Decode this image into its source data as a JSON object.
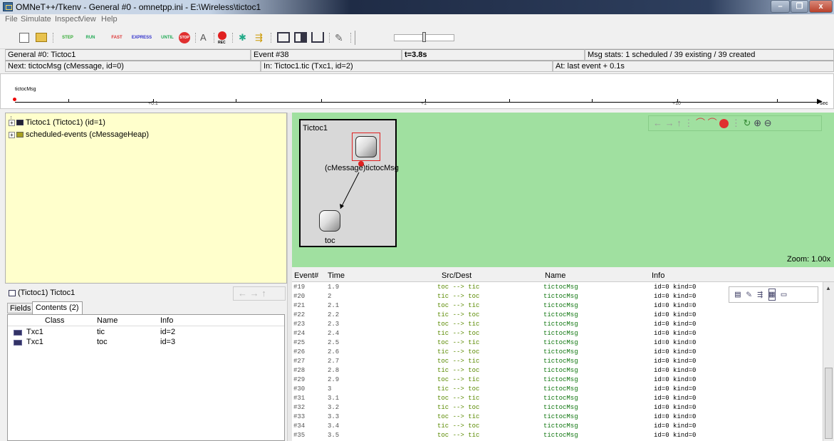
{
  "window": {
    "title": "OMNeT++/Tkenv - General #0 - omnetpp.ini - E:\\Wireless\\tictoc1",
    "minimize": "–",
    "maximize": "❐",
    "close": "x"
  },
  "menu": [
    "File",
    "Simulate",
    "Inspect",
    "View",
    "Help"
  ],
  "toolbar": {
    "step": "STEP",
    "run": "RUN",
    "fast": "FAST",
    "express": "EXPRESS",
    "until": "UNTIL",
    "stop": "STOP",
    "rec": "REC"
  },
  "status": {
    "run": "General #0: Tictoc1",
    "event": "Event #38",
    "time": "t=3.8s",
    "msgstats": "Msg stats: 1 scheduled / 39 existing / 39 created",
    "next": "Next: tictocMsg (cMessage, id=0)",
    "in": "In: Tictoc1.tic (Txc1, id=2)",
    "at": "At: last event + 0.1s"
  },
  "timeline": {
    "msg": "tictocMsg",
    "labels": [
      "+0.1",
      "+1",
      "+10",
      "sec"
    ]
  },
  "tree": {
    "items": [
      "Tictoc1 (Tictoc1) (id=1)",
      "scheduled-events (cMessageHeap)"
    ]
  },
  "inspector": {
    "title": "(Tictoc1) Tictoc1",
    "tabs": [
      "Fields",
      "Contents (2)"
    ],
    "columns": [
      "Class",
      "Name",
      "Info"
    ],
    "rows": [
      {
        "class": "Txc1",
        "name": "tic",
        "info": "id=2"
      },
      {
        "class": "Txc1",
        "name": "toc",
        "info": "id=3"
      }
    ]
  },
  "network": {
    "name": "Tictoc1",
    "msg_label": "(cMessage)tictocMsg",
    "node_toc": "toc",
    "zoom": "Zoom: 1.00x"
  },
  "log": {
    "columns": [
      "Event#",
      "Time",
      "Src/Dest",
      "Name",
      "Info"
    ],
    "rows": [
      {
        "e": "#19",
        "t": "1.9",
        "sd": "toc --> tic",
        "n": "tictocMsg",
        "i": "id=0  kind=0"
      },
      {
        "e": "#20",
        "t": "2",
        "sd": "tic --> toc",
        "n": "tictocMsg",
        "i": "id=0  kind=0"
      },
      {
        "e": "#21",
        "t": "2.1",
        "sd": "toc --> tic",
        "n": "tictocMsg",
        "i": "id=0  kind=0"
      },
      {
        "e": "#22",
        "t": "2.2",
        "sd": "tic --> toc",
        "n": "tictocMsg",
        "i": "id=0  kind=0"
      },
      {
        "e": "#23",
        "t": "2.3",
        "sd": "toc --> tic",
        "n": "tictocMsg",
        "i": "id=0  kind=0"
      },
      {
        "e": "#24",
        "t": "2.4",
        "sd": "tic --> toc",
        "n": "tictocMsg",
        "i": "id=0  kind=0"
      },
      {
        "e": "#25",
        "t": "2.5",
        "sd": "toc --> tic",
        "n": "tictocMsg",
        "i": "id=0  kind=0"
      },
      {
        "e": "#26",
        "t": "2.6",
        "sd": "tic --> toc",
        "n": "tictocMsg",
        "i": "id=0  kind=0"
      },
      {
        "e": "#27",
        "t": "2.7",
        "sd": "toc --> tic",
        "n": "tictocMsg",
        "i": "id=0  kind=0"
      },
      {
        "e": "#28",
        "t": "2.8",
        "sd": "tic --> toc",
        "n": "tictocMsg",
        "i": "id=0  kind=0"
      },
      {
        "e": "#29",
        "t": "2.9",
        "sd": "toc --> tic",
        "n": "tictocMsg",
        "i": "id=0  kind=0"
      },
      {
        "e": "#30",
        "t": "3",
        "sd": "tic --> toc",
        "n": "tictocMsg",
        "i": "id=0  kind=0"
      },
      {
        "e": "#31",
        "t": "3.1",
        "sd": "toc --> tic",
        "n": "tictocMsg",
        "i": "id=0  kind=0"
      },
      {
        "e": "#32",
        "t": "3.2",
        "sd": "tic --> toc",
        "n": "tictocMsg",
        "i": "id=0  kind=0"
      },
      {
        "e": "#33",
        "t": "3.3",
        "sd": "toc --> tic",
        "n": "tictocMsg",
        "i": "id=0  kind=0"
      },
      {
        "e": "#34",
        "t": "3.4",
        "sd": "tic --> toc",
        "n": "tictocMsg",
        "i": "id=0  kind=0"
      },
      {
        "e": "#35",
        "t": "3.5",
        "sd": "toc --> tic",
        "n": "tictocMsg",
        "i": "id=0  kind=0"
      }
    ]
  },
  "colors": {
    "tree_bg": "#ffffcc",
    "canvas_bg": "#a0e0a0",
    "srcdest": "#5a8a00",
    "name": "#117711"
  }
}
